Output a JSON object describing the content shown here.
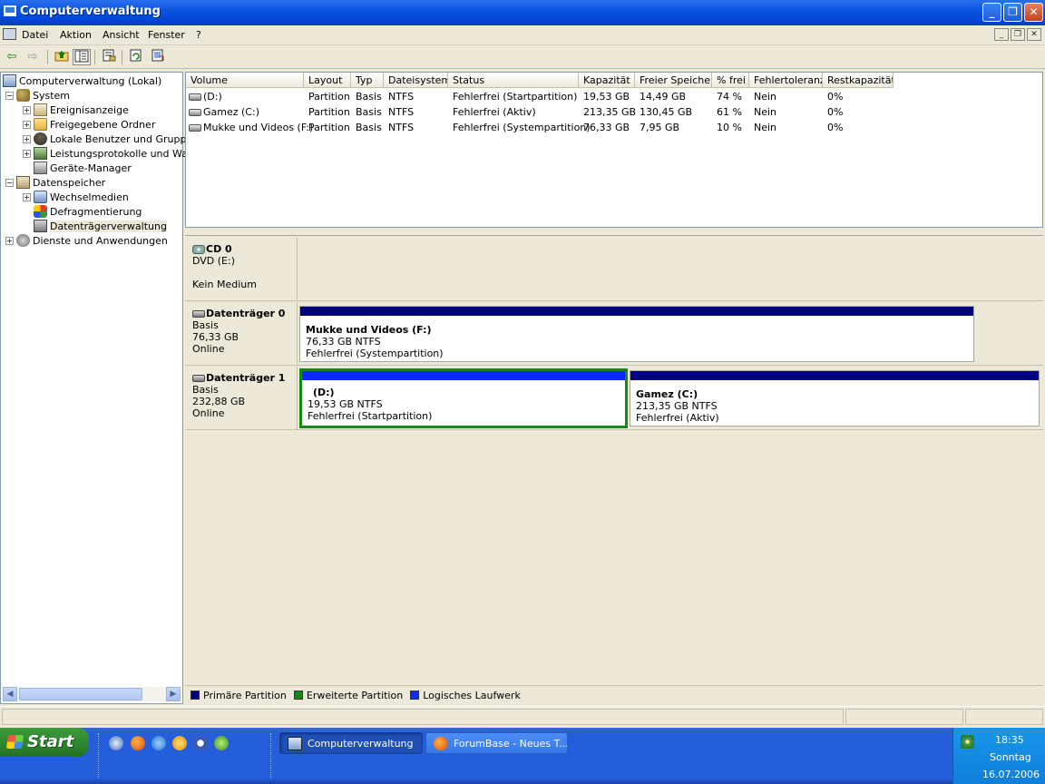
{
  "window": {
    "title": "Computerverwaltung",
    "buttons": {
      "minimize": "_",
      "maximize": "❐",
      "close": "✕"
    }
  },
  "menu": [
    "Datei",
    "Aktion",
    "Ansicht",
    "Fenster",
    "?"
  ],
  "mdi_buttons": [
    "_",
    "❐",
    "✕"
  ],
  "toolbar": {
    "back_icon": "⇦",
    "forward_icon": "⇨",
    "icons": [
      "up-folder-icon",
      "show-tree-icon",
      "properties-icon",
      "refresh-icon",
      "export-list-icon"
    ]
  },
  "tree": {
    "root": "Computerverwaltung (Lokal)",
    "items": [
      {
        "label": "System",
        "exp": "−"
      },
      {
        "label": "Ereignisanzeige",
        "exp": "+"
      },
      {
        "label": "Freigegebene Ordner",
        "exp": "+"
      },
      {
        "label": "Lokale Benutzer und Gruppen",
        "exp": "+"
      },
      {
        "label": "Leistungsprotokolle und Warnungen",
        "exp": "+"
      },
      {
        "label": "Geräte-Manager",
        "exp": ""
      },
      {
        "label": "Datenspeicher",
        "exp": "−"
      },
      {
        "label": "Wechselmedien",
        "exp": "+"
      },
      {
        "label": "Defragmentierung",
        "exp": ""
      },
      {
        "label": "Datenträgerverwaltung",
        "exp": ""
      },
      {
        "label": "Dienste und Anwendungen",
        "exp": "+"
      }
    ]
  },
  "volume_list": {
    "columns": [
      "Volume",
      "Layout",
      "Typ",
      "Dateisystem",
      "Status",
      "Kapazität",
      "Freier Speicher",
      "% frei",
      "Fehlertoleranz",
      "Restkapazität"
    ],
    "rows": [
      [
        "(D:)",
        "Partition",
        "Basis",
        "NTFS",
        "Fehlerfrei (Startpartition)",
        "19,53 GB",
        "14,49 GB",
        "74 %",
        "Nein",
        "0%"
      ],
      [
        "Gamez (C:)",
        "Partition",
        "Basis",
        "NTFS",
        "Fehlerfrei (Aktiv)",
        "213,35 GB",
        "130,45 GB",
        "61 %",
        "Nein",
        "0%"
      ],
      [
        "Mukke und Videos (F:)",
        "Partition",
        "Basis",
        "NTFS",
        "Fehlerfrei (Systempartition)",
        "76,33 GB",
        "7,95 GB",
        "10 %",
        "Nein",
        "0%"
      ]
    ]
  },
  "disks": {
    "cd0": {
      "name": "CD 0",
      "line1": "DVD (E:)",
      "line3": "Kein Medium"
    },
    "disk0": {
      "name": "Datenträger 0",
      "type": "Basis",
      "size": "76,33 GB",
      "state": "Online",
      "part": {
        "name": "Mukke und Videos  (F:)",
        "size": "76,33 GB NTFS",
        "status": "Fehlerfrei (Systempartition)",
        "color": "#000080"
      }
    },
    "disk1": {
      "name": "Datenträger 1",
      "type": "Basis",
      "size": "232,88 GB",
      "state": "Online",
      "part_d": {
        "name": "(D:)",
        "size": "19,53 GB NTFS",
        "status": "Fehlerfrei (Startpartition)",
        "color": "#0a2aff"
      },
      "part_c": {
        "name": "Gamez  (C:)",
        "size": "213,35 GB NTFS",
        "status": "Fehlerfrei (Aktiv)",
        "color": "#000080"
      }
    }
  },
  "legend": [
    {
      "label": "Primäre Partition",
      "color": "#000080"
    },
    {
      "label": "Erweiterte Partition",
      "color": "#148a14"
    },
    {
      "label": "Logisches Laufwerk",
      "color": "#0a2aff"
    }
  ],
  "taskbar": {
    "start": "Start",
    "tasks": [
      "Computerverwaltung",
      "ForumBase - Neues T..."
    ],
    "clock": {
      "time": "18:35",
      "day": "Sonntag",
      "date": "16.07.2006"
    }
  }
}
